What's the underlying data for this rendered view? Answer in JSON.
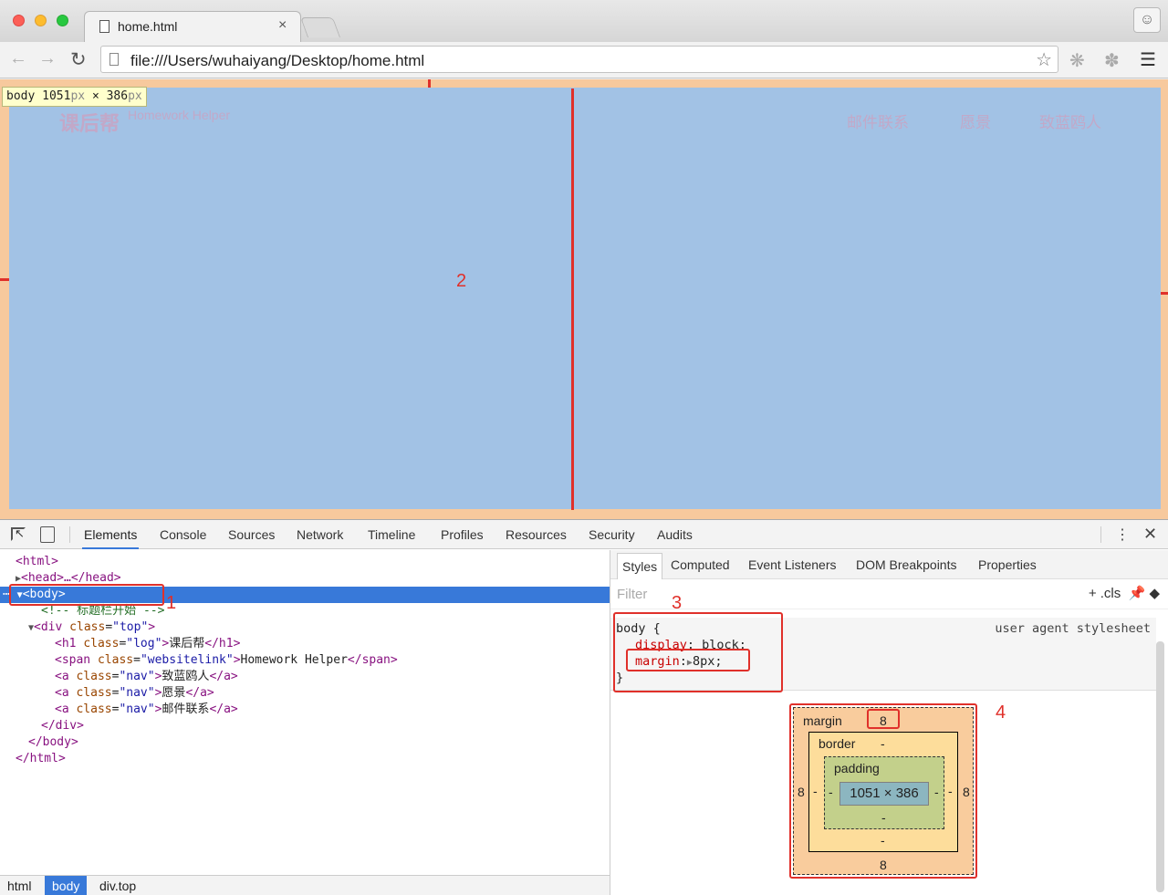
{
  "window": {
    "tab_title": "home.html",
    "tab_close": "×",
    "url": "file:///Users/wuhaiyang/Desktop/home.html"
  },
  "page": {
    "logo": "课后帮",
    "website_link": "Homework Helper",
    "nav": [
      "邮件联系",
      "愿景",
      "致蓝鸥人"
    ],
    "dim_tooltip": {
      "tag": "body",
      "width": "1051",
      "height": "386",
      "unit": "px",
      "sep": "×"
    }
  },
  "annotations": [
    "1",
    "2",
    "3",
    "4"
  ],
  "devtools": {
    "tabs": [
      "Elements",
      "Console",
      "Sources",
      "Network",
      "Timeline",
      "Profiles",
      "Resources",
      "Security",
      "Audits"
    ],
    "active_tab": "Elements",
    "dom": {
      "html_open": "<html>",
      "head": "<head>…</head>",
      "body_open": "<body>",
      "comment": "<!-- 标题栏开始 -->",
      "div_open_tag": "<div ",
      "div_attr": "class",
      "div_val": "\"top\"",
      "h1_tag": "<h1 ",
      "h1_attr": "class",
      "h1_val": "\"log\"",
      "h1_text": "课后帮",
      "h1_close": "</h1>",
      "span_tag": "<span ",
      "span_attr": "class",
      "span_val": "\"websitelink\"",
      "span_text": "Homework Helper",
      "span_close": "</span>",
      "a_tag": "<a ",
      "a_attr": "class",
      "a_val": "\"nav\"",
      "a1_text": "致蓝鸥人",
      "a2_text": "愿景",
      "a3_text": "邮件联系",
      "a_close": "</a>",
      "div_close": "</div>",
      "body_close": "</body>",
      "html_close": "</html>"
    },
    "breadcrumb": [
      "html",
      "body",
      "div.top"
    ],
    "styles_tabs": [
      "Styles",
      "Computed",
      "Event Listeners",
      "DOM Breakpoints",
      "Properties"
    ],
    "filter_placeholder": "Filter",
    "filter_tools": "+ .cls",
    "rule": {
      "selector": "body {",
      "origin": "user agent stylesheet",
      "prop1_name": "display",
      "prop1_value": "block;",
      "prop2_name": "margin",
      "prop2_value": "8px;",
      "close": "}"
    },
    "box_model": {
      "margin_label": "margin",
      "margin_top": "8",
      "margin_left": "8",
      "margin_right": "8",
      "margin_bottom": "8",
      "border_label": "border",
      "border_value": "-",
      "padding_label": "padding",
      "padding_value": "-",
      "content": "1051 × 386"
    }
  }
}
